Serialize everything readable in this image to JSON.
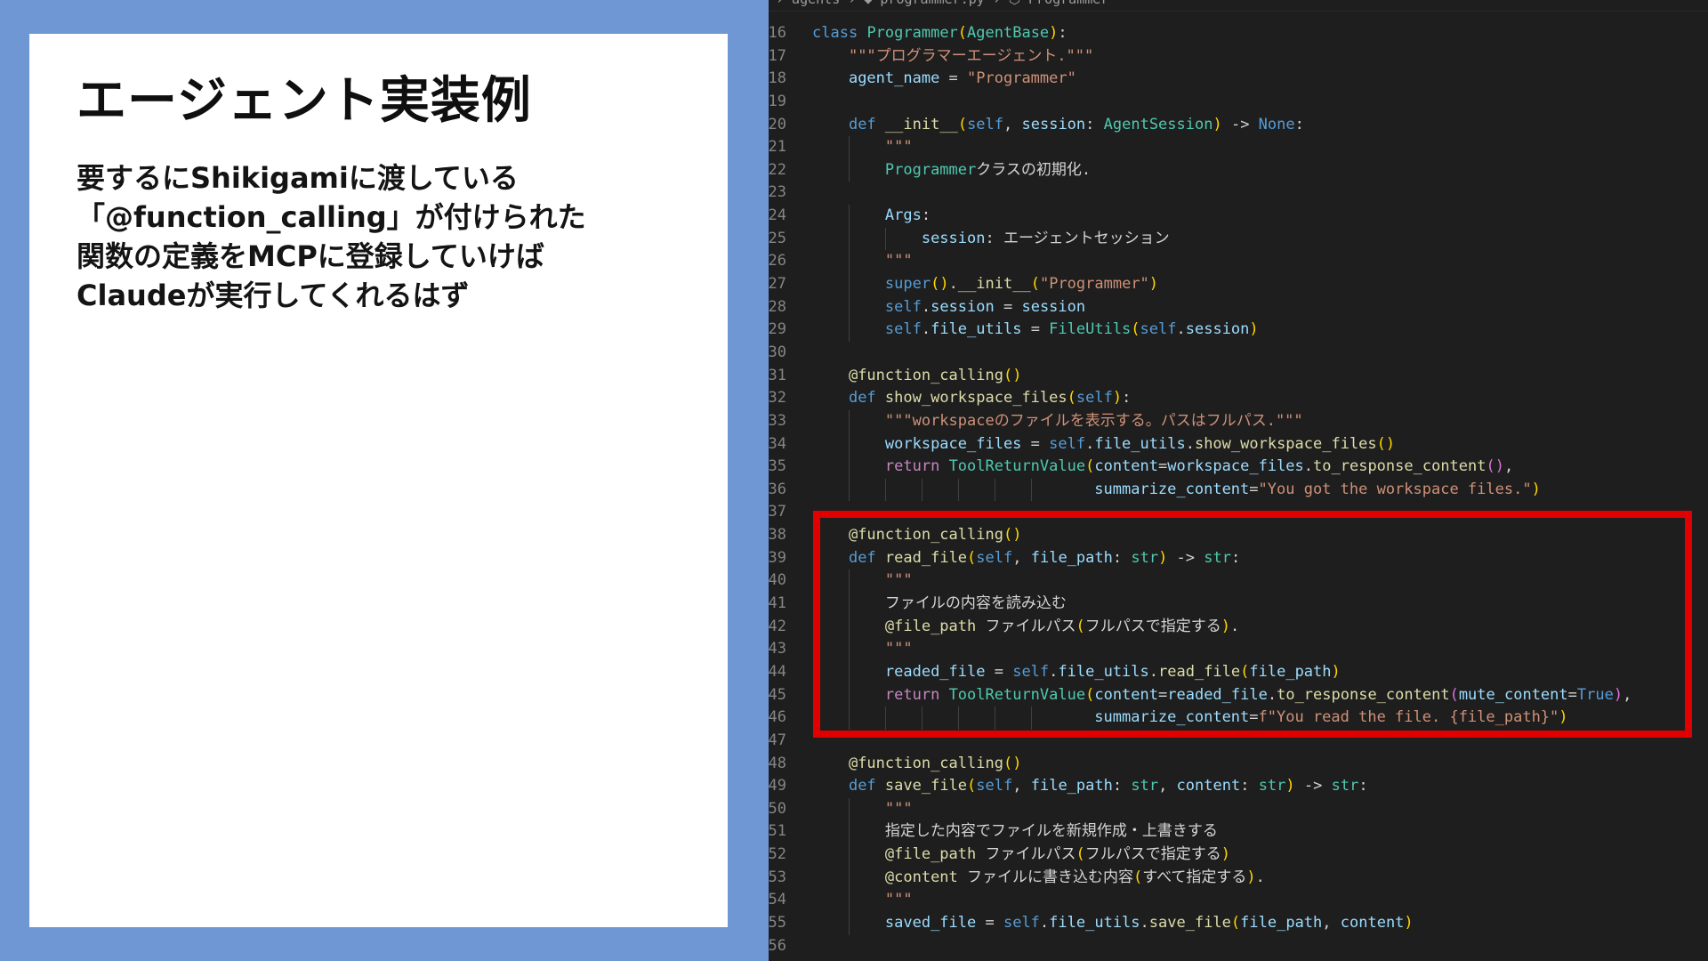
{
  "slide": {
    "title": "エージェント実装例",
    "description_lines": [
      "要するにShikigamiに渡している",
      "「@function_calling」が付けられた",
      "関数の定義をMCPに登録していけば",
      "Claudeが実行してくれるはず"
    ]
  },
  "editor": {
    "breadcrumb": "› agents › ◆ programmer.py › ⬡ Programmer",
    "line_numbers": [
      "16",
      "17",
      "18",
      "19",
      "20",
      "21",
      "22",
      "23",
      "24",
      "25",
      "26",
      "27",
      "28",
      "29",
      "30",
      "31",
      "32",
      "33",
      "34",
      "35",
      "36",
      "37",
      "38",
      "39",
      "40",
      "41",
      "42",
      "43",
      "44",
      "45",
      "46",
      "47",
      "48",
      "49",
      "50",
      "51",
      "52",
      "53",
      "54",
      "55",
      "56"
    ],
    "code_lines": [
      "class Programmer(AgentBase):",
      "    \"\"\"プログラマーエージェント.\"\"\"",
      "    agent_name = \"Programmer\"",
      "",
      "    def __init__(self, session: AgentSession) -> None:",
      "        \"\"\"",
      "        Programmerクラスの初期化.",
      "",
      "        Args:",
      "            session: エージェントセッション",
      "        \"\"\"",
      "        super().__init__(\"Programmer\")",
      "        self.session = session",
      "        self.file_utils = FileUtils(self.session)",
      "",
      "    @function_calling()",
      "    def show_workspace_files(self):",
      "        \"\"\"workspaceのファイルを表示する。パスはフルパス.\"\"\"",
      "        workspace_files = self.file_utils.show_workspace_files()",
      "        return ToolReturnValue(content=workspace_files.to_response_content(),",
      "                               summarize_content=\"You got the workspace files.\")",
      "",
      "    @function_calling()",
      "    def read_file(self, file_path: str) -> str:",
      "        \"\"\"",
      "        ファイルの内容を読み込む",
      "        @file_path ファイルパス(フルパスで指定する).",
      "        \"\"\"",
      "        readed_file = self.file_utils.read_file(file_path)",
      "        return ToolReturnValue(content=readed_file.to_response_content(mute_content=True),",
      "                               summarize_content=f\"You read the file. {file_path}\")",
      "",
      "    @function_calling()",
      "    def save_file(self, file_path: str, content: str) -> str:",
      "        \"\"\"",
      "        指定した内容でファイルを新規作成・上書きする",
      "        @file_path ファイルパス(フルパスで指定する)",
      "        @content ファイルに書き込む内容(すべて指定する).",
      "        \"\"\"",
      "        saved_file = self.file_utils.save_file(file_path, content)",
      ""
    ]
  },
  "colors": {
    "slide_background": "#6f97d3",
    "editor_background": "#1e1e1e",
    "highlight_border": "#e00000"
  }
}
